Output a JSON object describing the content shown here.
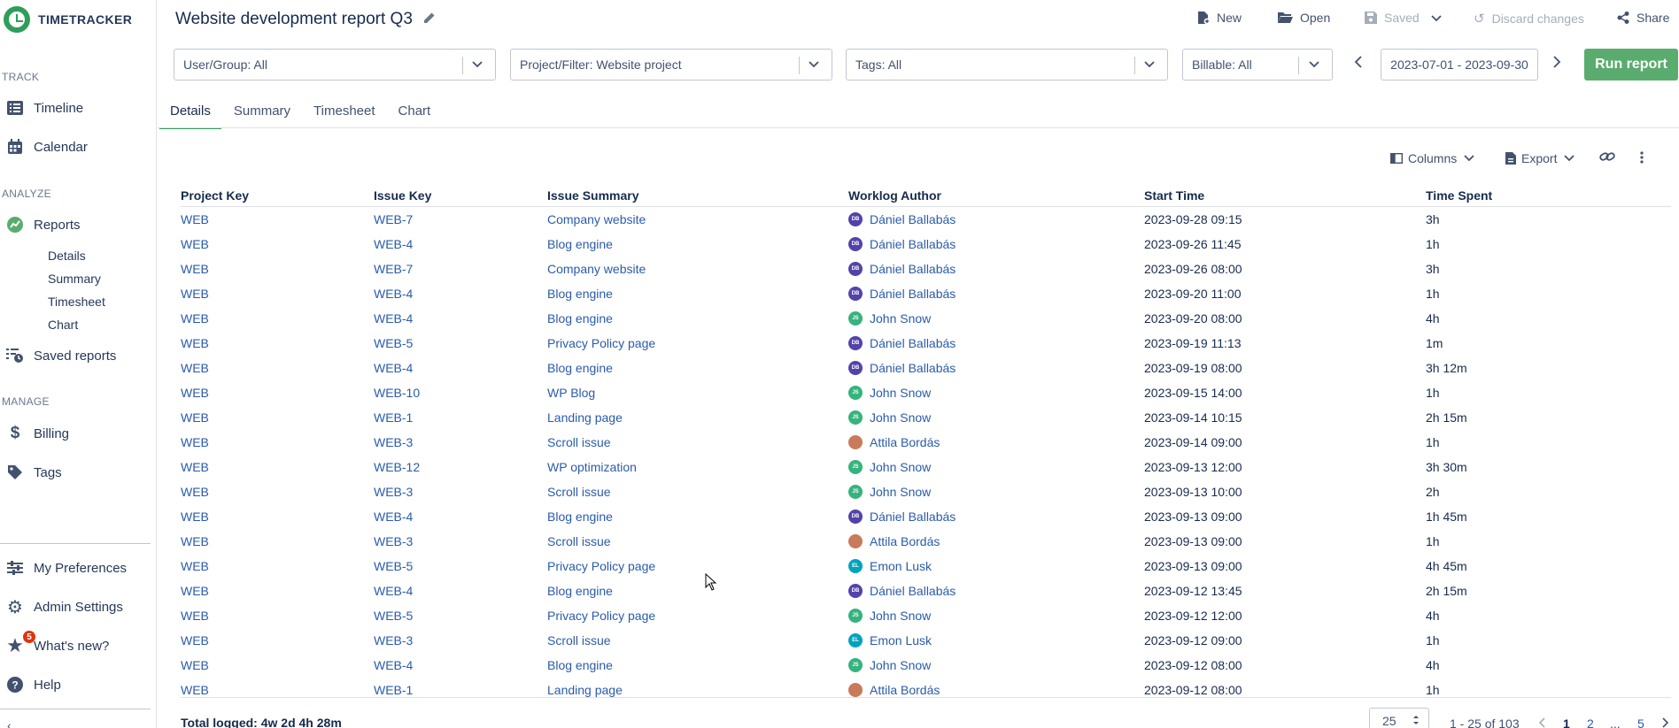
{
  "app": {
    "name": "TIMETRACKER",
    "accent": "#2e9e5b"
  },
  "sidebar": {
    "sections": {
      "track": "TRACK",
      "analyze": "ANALYZE",
      "manage": "MANAGE"
    },
    "timeline": "Timeline",
    "calendar": "Calendar",
    "reports": "Reports",
    "report_sub": [
      "Details",
      "Summary",
      "Timesheet",
      "Chart"
    ],
    "saved_reports": "Saved reports",
    "billing": "Billing",
    "tags": "Tags",
    "my_preferences": "My Preferences",
    "admin_settings": "Admin Settings",
    "whats_new": "What's new?",
    "whats_new_badge": "5",
    "help": "Help"
  },
  "header": {
    "title": "Website development report Q3",
    "new": "New",
    "open": "Open",
    "saved": "Saved",
    "discard": "Discard changes",
    "share": "Share"
  },
  "filters": {
    "user_group": "User/Group: All",
    "project": "Project/Filter: Website project",
    "tags": "Tags: All",
    "billable": "Billable: All",
    "date_range": "2023-07-01 - 2023-09-30",
    "run": "Run report"
  },
  "tabs": [
    "Details",
    "Summary",
    "Timesheet",
    "Chart"
  ],
  "table_tools": {
    "columns": "Columns",
    "export": "Export"
  },
  "table": {
    "headers": [
      "Project Key",
      "Issue Key",
      "Issue Summary",
      "Worklog Author",
      "Start Time",
      "Time Spent"
    ],
    "rows": [
      [
        "WEB",
        "WEB-7",
        "Company website",
        "Dániel Ballabás",
        "2023-09-28 09:15",
        "3h"
      ],
      [
        "WEB",
        "WEB-4",
        "Blog engine",
        "Dániel Ballabás",
        "2023-09-26 11:45",
        "1h"
      ],
      [
        "WEB",
        "WEB-7",
        "Company website",
        "Dániel Ballabás",
        "2023-09-26 08:00",
        "3h"
      ],
      [
        "WEB",
        "WEB-4",
        "Blog engine",
        "Dániel Ballabás",
        "2023-09-20 11:00",
        "1h"
      ],
      [
        "WEB",
        "WEB-4",
        "Blog engine",
        "John Snow",
        "2023-09-20 08:00",
        "4h"
      ],
      [
        "WEB",
        "WEB-5",
        "Privacy Policy page",
        "Dániel Ballabás",
        "2023-09-19 11:13",
        "1m"
      ],
      [
        "WEB",
        "WEB-4",
        "Blog engine",
        "Dániel Ballabás",
        "2023-09-19 08:00",
        "3h 12m"
      ],
      [
        "WEB",
        "WEB-10",
        "WP Blog",
        "John Snow",
        "2023-09-15 14:00",
        "1h"
      ],
      [
        "WEB",
        "WEB-1",
        "Landing page",
        "John Snow",
        "2023-09-14 10:15",
        "2h 15m"
      ],
      [
        "WEB",
        "WEB-3",
        "Scroll issue",
        "Attila Bordás",
        "2023-09-14 09:00",
        "1h"
      ],
      [
        "WEB",
        "WEB-12",
        "WP optimization",
        "John Snow",
        "2023-09-13 12:00",
        "3h 30m"
      ],
      [
        "WEB",
        "WEB-3",
        "Scroll issue",
        "John Snow",
        "2023-09-13 10:00",
        "2h"
      ],
      [
        "WEB",
        "WEB-4",
        "Blog engine",
        "Dániel Ballabás",
        "2023-09-13 09:00",
        "1h 45m"
      ],
      [
        "WEB",
        "WEB-3",
        "Scroll issue",
        "Attila Bordás",
        "2023-09-13 09:00",
        "1h"
      ],
      [
        "WEB",
        "WEB-5",
        "Privacy Policy page",
        "Emon Lusk",
        "2023-09-13 09:00",
        "4h 45m"
      ],
      [
        "WEB",
        "WEB-4",
        "Blog engine",
        "Dániel Ballabás",
        "2023-09-12 13:45",
        "2h 15m"
      ],
      [
        "WEB",
        "WEB-5",
        "Privacy Policy page",
        "John Snow",
        "2023-09-12 12:00",
        "4h"
      ],
      [
        "WEB",
        "WEB-3",
        "Scroll issue",
        "Emon Lusk",
        "2023-09-12 09:00",
        "1h"
      ],
      [
        "WEB",
        "WEB-4",
        "Blog engine",
        "John Snow",
        "2023-09-12 08:00",
        "4h"
      ],
      [
        "WEB",
        "WEB-1",
        "Landing page",
        "Attila Bordás",
        "2023-09-12 08:00",
        "1h"
      ]
    ],
    "avatars": {
      "Dániel Ballabás": {
        "initials": "DB",
        "color": "#5243aa"
      },
      "John Snow": {
        "initials": "JS",
        "color": "#36b37e"
      },
      "Emon Lusk": {
        "initials": "EL",
        "color": "#00a3bf"
      },
      "Attila Bordás": {
        "initials": "",
        "color": "#c97a5a"
      }
    }
  },
  "footer": {
    "total": "Total logged: 4w 2d 4h 28m",
    "page_size": "25",
    "range": "1 - 25 of 103",
    "pages": [
      "1",
      "2",
      "...",
      "5"
    ]
  }
}
